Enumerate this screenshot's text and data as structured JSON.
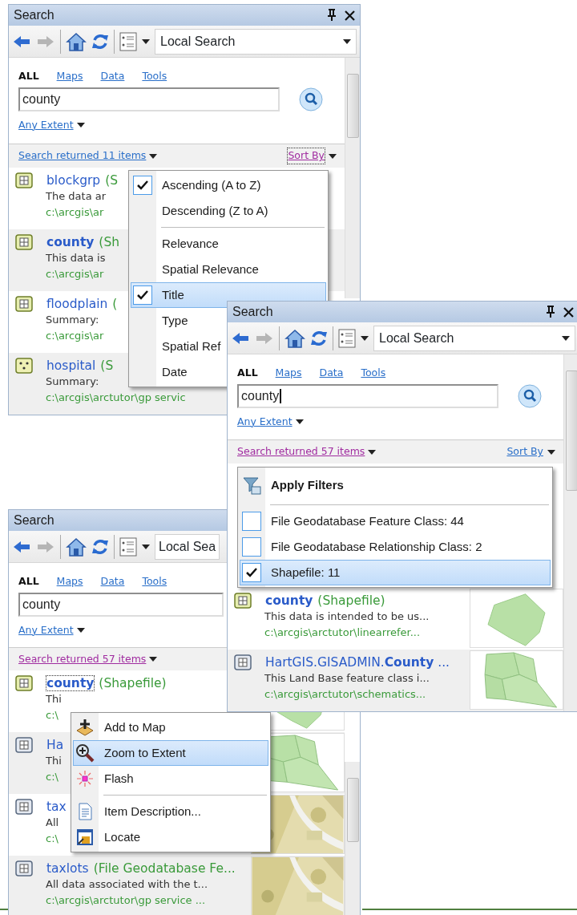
{
  "windows": [
    {
      "title": "Search",
      "title_buttons": true,
      "forward_disabled": true,
      "scope": "Local Search",
      "scope_caret": true,
      "tabs": [
        {
          "label": "ALL",
          "selected": true
        },
        {
          "label": "Maps",
          "selected": false
        },
        {
          "label": "Data",
          "selected": false
        },
        {
          "label": "Tools",
          "selected": false
        }
      ],
      "search": {
        "value": "county",
        "focused": false
      },
      "search_button": true,
      "extent": "Any Extent",
      "summary": {
        "label": "Search returned 11 items",
        "visited": false
      },
      "sort": {
        "label": "Sort By",
        "visited": true,
        "focused": true
      },
      "results": [
        {
          "kind": "shapefile",
          "name": "blockgrp",
          "type": "(S",
          "summary": "The data ar",
          "path": "c:\\arcgis\\ar",
          "focused": false
        },
        {
          "kind": "shapefile",
          "name": "**county**",
          "type": "(Sh",
          "summary": "This data is",
          "path": "c:\\arcgis\\ar",
          "focused": false
        },
        {
          "kind": "shapefile",
          "name": "floodplain",
          "type": "(",
          "summary": "Summary:",
          "path": "c:\\arcgis\\ar",
          "focused": false
        },
        {
          "kind": "point",
          "name": "hospital",
          "type": "(S",
          "summary": "Summary:",
          "path": "c:\\arcgis\\arctutor\\gp servic",
          "focused": false
        }
      ],
      "sort_menu": [
        {
          "kind": "option",
          "label": "Ascending (A to Z)",
          "checked": true,
          "selected": false
        },
        {
          "kind": "option",
          "label": "Descending (Z to A)",
          "checked": false,
          "selected": false
        },
        {
          "kind": "separator"
        },
        {
          "kind": "option",
          "label": "Relevance",
          "checked": false,
          "selected": false
        },
        {
          "kind": "option",
          "label": "Spatial Relevance",
          "checked": false,
          "selected": false
        },
        {
          "kind": "option",
          "label": "Title",
          "checked": true,
          "selected": true
        },
        {
          "kind": "option",
          "label": "Type",
          "checked": false,
          "selected": false
        },
        {
          "kind": "option",
          "label": "Spatial Ref",
          "checked": false,
          "selected": false
        },
        {
          "kind": "option",
          "label": "Date",
          "checked": false,
          "selected": false
        }
      ]
    },
    {
      "title": "Search",
      "title_buttons": false,
      "forward_disabled": true,
      "scope": "Local Sea",
      "scope_caret": false,
      "tabs": [
        {
          "label": "ALL",
          "selected": true
        },
        {
          "label": "Maps",
          "selected": false
        },
        {
          "label": "Data",
          "selected": false
        },
        {
          "label": "Tools",
          "selected": false
        }
      ],
      "search": {
        "value": "county",
        "focused": false
      },
      "search_button": false,
      "extent": "Any Extent",
      "summary": {
        "label": "Search returned 57 items",
        "visited": true
      },
      "results": [
        {
          "kind": "shapefile",
          "name": "**county**",
          "type": "(Shapefile)",
          "summary": "Thi",
          "path": "c:\\",
          "focused": true,
          "has_preview": true
        },
        {
          "kind": "geodatabase",
          "name": "Ha",
          "summary": "Thi",
          "path": "c:\\",
          "focused": false,
          "has_preview": true
        },
        {
          "kind": "geodatabase",
          "name": "tax",
          "summary": "All",
          "path": "c:\\",
          "focused": false,
          "has_preview": true
        },
        {
          "kind": "geodatabase",
          "name": "taxlots",
          "type": "(File Geodatabase Fe...",
          "summary": "All data associated with the t...",
          "path": "c:\\arcgis\\arctutor\\gp service ...",
          "focused": false,
          "has_preview": true
        }
      ],
      "context_menu": [
        {
          "kind": "command",
          "label": "Add to Map",
          "selected": false
        },
        {
          "kind": "command",
          "label": "Zoom to Extent",
          "selected": true
        },
        {
          "kind": "command",
          "label": "Flash",
          "selected": false
        },
        {
          "kind": "separator"
        },
        {
          "kind": "command",
          "label": "Item Description...",
          "selected": false
        },
        {
          "kind": "command",
          "label": "Locate",
          "selected": false
        }
      ]
    },
    {
      "title": "Search",
      "title_buttons": true,
      "forward_disabled": true,
      "scope": "Local Search",
      "scope_caret": true,
      "tabs": [
        {
          "label": "ALL",
          "selected": true
        },
        {
          "label": "Maps",
          "selected": false
        },
        {
          "label": "Data",
          "selected": false
        },
        {
          "label": "Tools",
          "selected": false
        }
      ],
      "search": {
        "value": "county",
        "focused": true
      },
      "search_button": true,
      "extent": "Any Extent",
      "summary": {
        "label": "Search returned 57 items",
        "visited": true
      },
      "sort": {
        "label": "Sort By",
        "visited": false,
        "focused": false
      },
      "results": [
        {
          "kind": "shapefile",
          "name": "**county**",
          "type": "(Shapefile)",
          "summary": "This data is intended to be us...",
          "path": "c:\\arcgis\\arctutor\\linearrefer...",
          "focused": false,
          "has_preview": true
        },
        {
          "kind": "geodatabase",
          "name": "HartGIS.GISADMIN.**County** ...",
          "summary": "This Land Base feature class i...",
          "path": "c:\\arcgis\\arctutor\\schematics...",
          "focused": false,
          "has_preview": true
        }
      ],
      "filter_menu": [
        {
          "kind": "header",
          "label": "Apply Filters"
        },
        {
          "kind": "separator"
        },
        {
          "kind": "checkbox",
          "label": "File Geodatabase Feature Class: 44",
          "checked": false,
          "selected": false
        },
        {
          "kind": "checkbox",
          "label": "File Geodatabase Relationship Class: 2",
          "checked": false,
          "selected": false
        },
        {
          "kind": "checkbox",
          "label": "Shapefile: 11",
          "checked": true,
          "selected": true
        }
      ]
    }
  ]
}
